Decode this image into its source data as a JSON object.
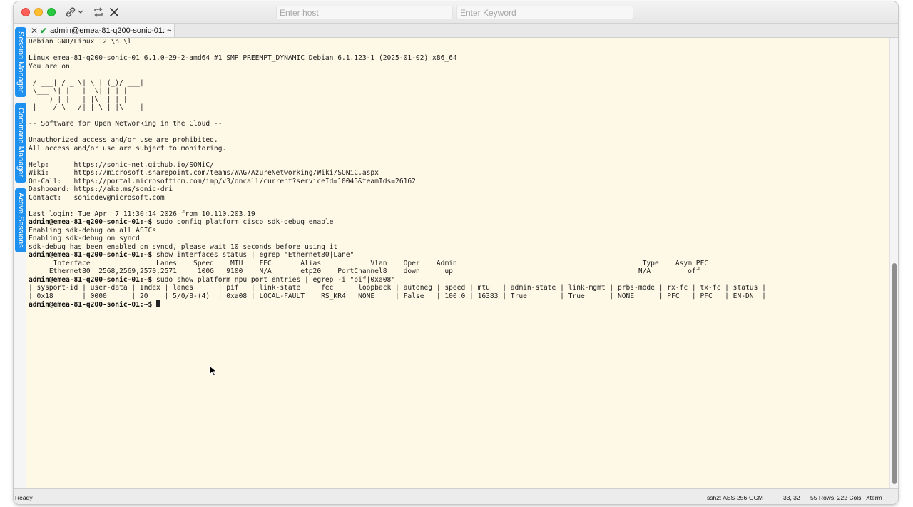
{
  "window": {
    "host_placeholder": "Enter host",
    "keyword_placeholder": "Enter Keyword"
  },
  "side_tabs": [
    {
      "label": "Session Manager"
    },
    {
      "label": "Command Manager"
    },
    {
      "label": "Active Sessions"
    }
  ],
  "tab": {
    "title": "admin@emea-81-q200-sonic-01: ~"
  },
  "terminal": {
    "lines": [
      "Debian GNU/Linux 12 \\n \\l",
      "",
      "Linux emea-81-q200-sonic-01 6.1.0-29-2-amd64 #1 SMP PREEMPT_DYNAMIC Debian 6.1.123-1 (2025-01-02) x86_64",
      "You are on",
      "  ____   ___  _   _ _  ____",
      " / ___| / _ \\| \\ | (_)/ ___|",
      " \\___ \\| | | |  \\| | | |",
      "  ___) | |_| | |\\  | | |___",
      " |____/ \\___/|_| \\_|_|\\____|",
      "",
      "-- Software for Open Networking in the Cloud --",
      "",
      "Unauthorized access and/or use are prohibited.",
      "All access and/or use are subject to monitoring.",
      "",
      "Help:      https://sonic-net.github.io/SONiC/",
      "Wiki:      https://microsoft.sharepoint.com/teams/WAG/AzureNetworking/Wiki/SONiC.aspx",
      "On-Call:   https://portal.microsofticm.com/imp/v3/oncall/current?serviceId=10045&teamIds=26162",
      "Dashboard: https://aka.ms/sonic-dri",
      "Contact:   sonicdev@microsoft.com",
      "",
      "Last login: Tue Apr  7 11:30:14 2026 from 10.110.203.19"
    ],
    "session": [
      {
        "prompt": "admin@emea-81-q200-sonic-01:~$",
        "text": " sudo config platform cisco sdk-debug enable"
      },
      {
        "prompt": "",
        "text": "Enabling sdk-debug on all ASICs"
      },
      {
        "prompt": "",
        "text": "Enabling sdk-debug on syncd"
      },
      {
        "prompt": "",
        "text": "sdk-debug has been enabled on syncd, please wait 10 seconds before using it"
      },
      {
        "prompt": "admin@emea-81-q200-sonic-01:~$",
        "text": " show interfaces status | egrep \"Ethernet80|Lane\""
      },
      {
        "prompt": "",
        "text": "      Interface                Lanes    Speed    MTU    FEC       Alias            Vlan    Oper    Admin                                             Type    Asym PFC"
      },
      {
        "prompt": "",
        "text": "     Ethernet80  2568,2569,2570,2571     100G   9100    N/A       etp20    PortChannel8    down      up                                             N/A         off"
      },
      {
        "prompt": "admin@emea-81-q200-sonic-01:~$",
        "text": " sudo show platform npu port entries | egrep -i \"pif|0xa08\""
      },
      {
        "prompt": "",
        "text": "| sysport-id | user-data | Index | lanes      | pif   | link-state   | fec    | loopback | autoneg | speed | mtu   | admin-state | link-mgmt | prbs-mode | rx-fc | tx-fc | status |"
      },
      {
        "prompt": "",
        "text": "| 0x18       | 0000      | 20    | 5/0/8-(4)  | 0xa08 | LOCAL-FAULT  | RS_KR4 | NONE     | False   | 100.0 | 16383 | True        | True      | NONE      | PFC   | PFC   | EN-DN  |"
      },
      {
        "prompt": "admin@emea-81-q200-sonic-01:~$",
        "text": " ",
        "cursor": true
      }
    ]
  },
  "status_bar": {
    "ready": "Ready",
    "cipher": "ssh2: AES-256-GCM",
    "position": "33,  32",
    "size": "55 Rows, 222 Cols",
    "term_type": "Xterm"
  }
}
